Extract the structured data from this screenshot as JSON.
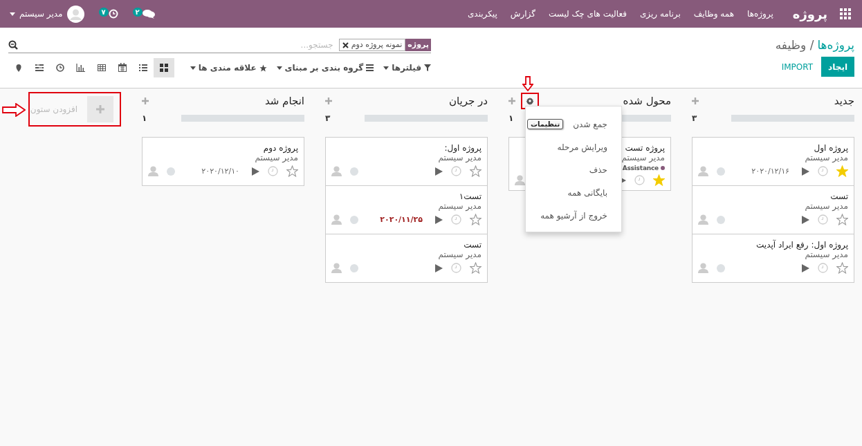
{
  "navbar": {
    "brand": "پروژه",
    "menu": [
      {
        "label": "پروژه‌ها"
      },
      {
        "label": "همه وظایف"
      },
      {
        "label": "برنامه ریزی"
      },
      {
        "label": "فعالیت های چک لیست"
      },
      {
        "label": "گزارش"
      },
      {
        "label": "پیکربندی"
      }
    ],
    "chat_badge": "۲",
    "activity_badge": "۷",
    "user": "مدیر سیستم"
  },
  "breadcrumb": {
    "parent": "پروژه‌ها",
    "current": "/ وظیفه"
  },
  "search": {
    "facet_label": "پروژه",
    "facet_value": "نمونه پروژه دوم",
    "placeholder": "جستجو..."
  },
  "buttons": [
    {
      "label": "ایجاد",
      "kind": "primary"
    },
    {
      "label": "IMPORT",
      "kind": "link"
    }
  ],
  "filters": [
    {
      "label": "فیلترها",
      "kind": "filter"
    },
    {
      "label": "گروه بندی بر مبنای",
      "kind": "group"
    },
    {
      "label": "علاقه مندی ها",
      "kind": "favorite"
    }
  ],
  "views": [
    {
      "kind": "kanban",
      "selected": true
    },
    {
      "kind": "list",
      "selected": false
    },
    {
      "kind": "calendar",
      "selected": false
    },
    {
      "kind": "pivot",
      "selected": false
    },
    {
      "kind": "graph",
      "selected": false
    },
    {
      "kind": "activity",
      "selected": false
    },
    {
      "kind": "gantt",
      "selected": false
    },
    {
      "kind": "map",
      "selected": false
    }
  ],
  "columns": [
    {
      "title": "جدید",
      "count": "۳",
      "level": 0,
      "settings_open": false,
      "cards": [
        {
          "title": "پروژه اول",
          "subtitle": "مدیر سیستم",
          "date": "۲۰۲۰/۱۲/۱۶",
          "overdue": false,
          "starred": true
        },
        {
          "title": "تست",
          "subtitle": "مدیر سیستم",
          "starred": false
        },
        {
          "title": "پروژه اول: رفع ایراد آپدیت",
          "subtitle": "مدیر سیستم",
          "starred": false
        }
      ]
    },
    {
      "title": "محول شده",
      "count": "۱",
      "level": 0,
      "settings_open": true,
      "menu": [
        {
          "label": "جمع شدن"
        },
        {
          "label": "ویرایش مرحله"
        },
        {
          "label": "حذف"
        },
        {
          "label": "بایگانی همه"
        },
        {
          "label": "خروج از آرشیو همه"
        }
      ],
      "tooltip": "تنظیمات",
      "cards": [
        {
          "title": "پروژه تست",
          "subtitle": "مدیر سیستم",
          "tags": [
            {
              "label": "Assistance",
              "color": "#875a7b"
            }
          ],
          "starred": true
        }
      ]
    },
    {
      "title": "در جریان",
      "count": "۳",
      "level": 0,
      "settings_open": false,
      "cards": [
        {
          "title": "پروژه اول:",
          "subtitle": "مدیر سیستم",
          "starred": false
        },
        {
          "title": "تست۱",
          "subtitle": "مدیر سیستم",
          "date": "۲۰۲۰/۱۱/۲۵",
          "overdue": true,
          "starred": false
        },
        {
          "title": "تست",
          "subtitle": "مدیر سیستم",
          "starred": false
        }
      ]
    },
    {
      "title": "انجام شد",
      "count": "۱",
      "level": 0,
      "settings_open": false,
      "cards": [
        {
          "title": "پروژه دوم",
          "subtitle": "مدیر سیستم",
          "date": "۲۰۲۰/۱۲/۱۰",
          "overdue": false,
          "starred": false
        }
      ]
    }
  ],
  "add_column": {
    "label": "افزودن ستون",
    "highlighted": true
  }
}
